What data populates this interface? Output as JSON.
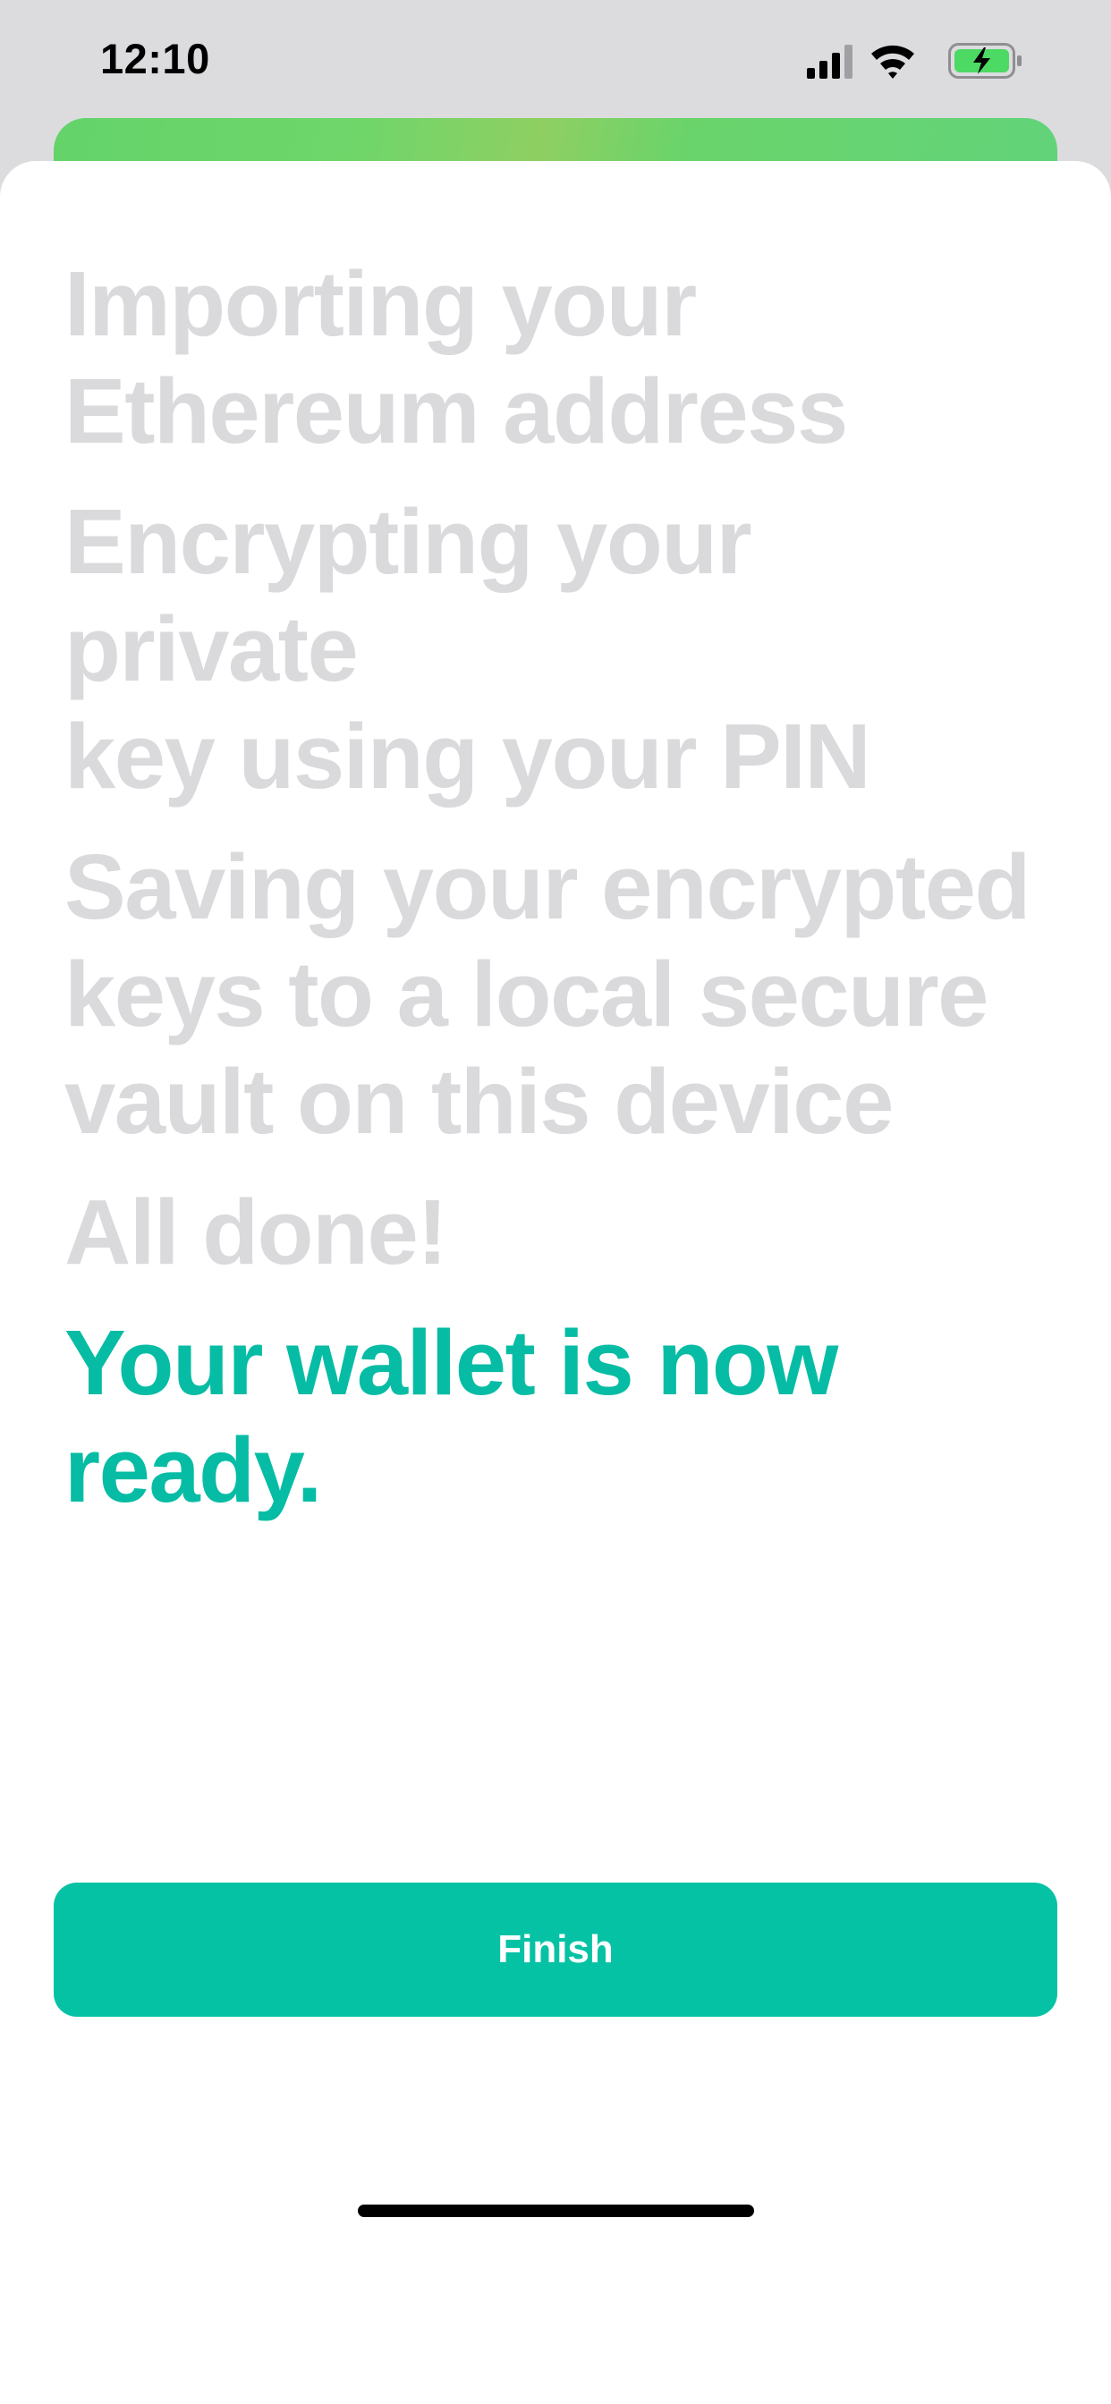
{
  "status_bar": {
    "time": "12:10",
    "icons": [
      "cellular-signal-icon",
      "wifi-icon",
      "battery-charging-icon"
    ],
    "battery_color": "#4cd964"
  },
  "steps": [
    {
      "text": "Importing your\nEthereum address",
      "state": "inactive"
    },
    {
      "text": "Encrypting your private\nkey using your PIN",
      "state": "inactive"
    },
    {
      "text": "Saving your encrypted\nkeys to a local secure\nvault on this device",
      "state": "inactive"
    },
    {
      "text": "All done!",
      "state": "inactive"
    },
    {
      "text": "Your wallet is now\nready.",
      "state": "complete"
    }
  ],
  "finish_button": {
    "label": "Finish"
  },
  "colors": {
    "accent": "#06c2a4",
    "inactive_text": "#dadadd",
    "background_dim": "#dcdcdf"
  }
}
